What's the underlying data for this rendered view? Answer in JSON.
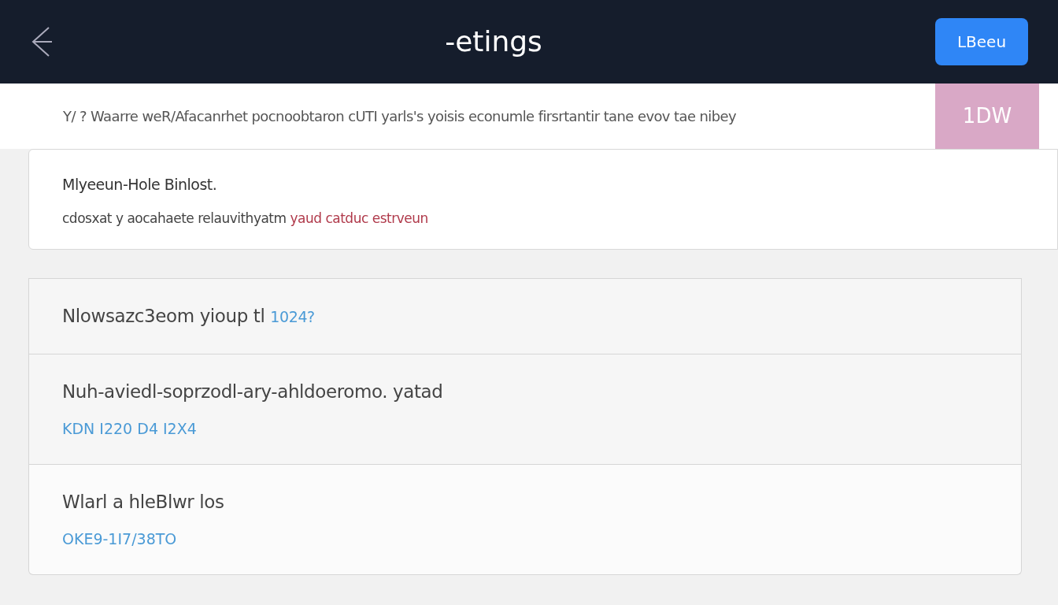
{
  "header": {
    "title": "-etings",
    "action": "LBeeu"
  },
  "banner": {
    "text": "Y/ ? Waarre weR/Afacanrhet pocnoobtaron cUTI yarls's yoisis econumle firsrtantir tane evov tae nibey",
    "badge": "1DW"
  },
  "notice": {
    "title": "Mlyeeun-Hole Binlost.",
    "parts": [
      {
        "text": "cdosxat y aocahaete relauvithyatm",
        "kind": "plain"
      },
      {
        "text": "yaud catduc estrveun",
        "kind": "alert"
      }
    ]
  },
  "items": [
    {
      "title": "Nlowsazc3eom yioup tl",
      "detail": "1024?"
    },
    {
      "title": "Nuh-aviedl-soprzodl-ary-ahldoeromo. yatad",
      "detail": "KDN I220 D4 I2X4"
    },
    {
      "title": "Wlarl   a hleBlwr los",
      "detail": "OKE9-1I7/38TO"
    }
  ]
}
